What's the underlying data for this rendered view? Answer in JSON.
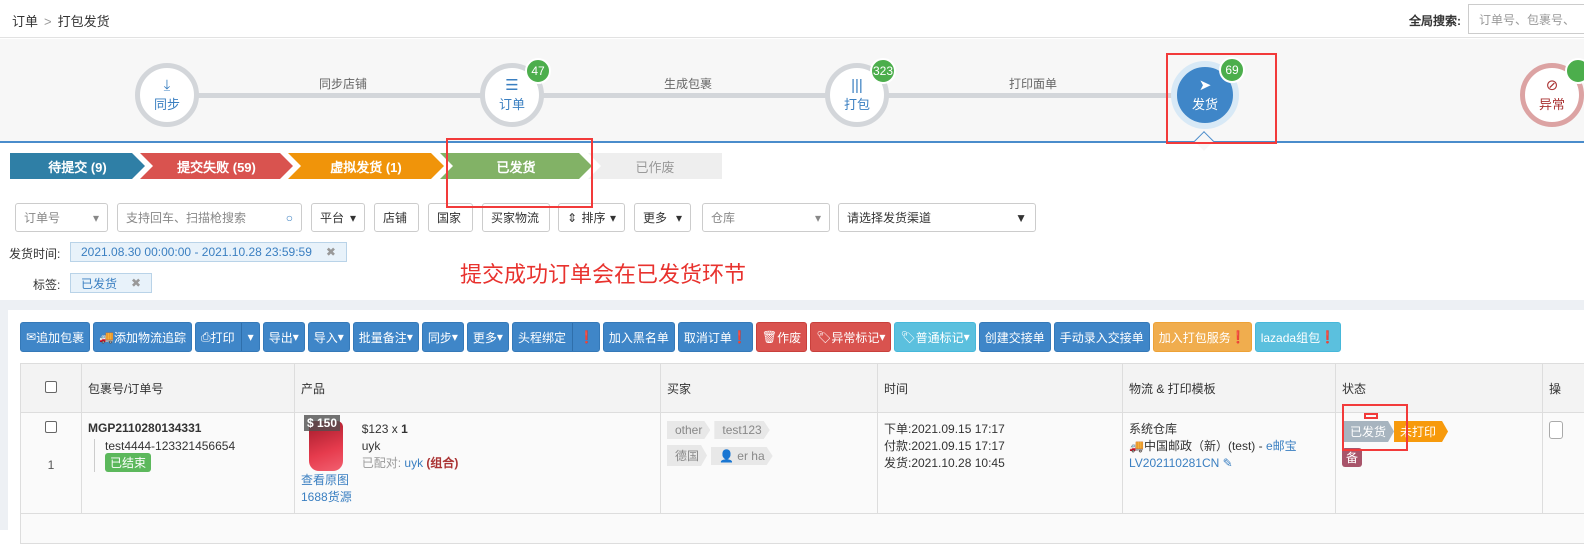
{
  "breadcrumb": {
    "root": "订单",
    "current": "打包发货"
  },
  "global_search": {
    "label": "全局搜索:",
    "placeholder": "订单号、包裹号、"
  },
  "steps": [
    {
      "label": "同步",
      "icon": "download-icon",
      "badge": null
    },
    {
      "label": "订单",
      "icon": "list-icon",
      "badge": "47"
    },
    {
      "label": "打包",
      "icon": "barcode-icon",
      "badge": "323"
    },
    {
      "label": "发货",
      "icon": "paper-plane-icon",
      "badge": "69",
      "active": true
    },
    {
      "label": "异常",
      "icon": "eye-slash-icon",
      "badge": ""
    }
  ],
  "connectors": [
    "同步店铺",
    "生成包裹",
    "打印面单"
  ],
  "status_tabs": [
    {
      "label": "待提交 (9)",
      "color": "#2f7fa6"
    },
    {
      "label": "提交失败 (59)",
      "color": "#d9534f"
    },
    {
      "label": "虚拟发货 (1)",
      "color": "#f0940a"
    },
    {
      "label": "已发货",
      "color": "#82b266",
      "active": true
    },
    {
      "label": "已作废",
      "color": "#eeeeee"
    }
  ],
  "filters": {
    "order_select": "订单号",
    "search_placeholder": "支持回车、扫描枪搜索",
    "platform": "平台",
    "shop": "店铺",
    "country": "国家",
    "buyer_logistics": "买家物流",
    "sort": "排序",
    "more": "更多",
    "warehouse": "仓库",
    "channel": "请选择发货渠道"
  },
  "active_filters": {
    "time_label": "发货时间:",
    "time_value": "2021.08.30 00:00:00 - 2021.10.28 23:59:59",
    "tag_label": "标签:",
    "tag_value": "已发货"
  },
  "annotation": "提交成功订单会在已发货环节",
  "toolbar": [
    "追加包裹",
    "添加物流追踪",
    "打印",
    "导出",
    "导入",
    "批量备注",
    "同步",
    "更多",
    "头程绑定",
    "加入黑名单",
    "取消订单",
    "作废",
    "异常标记",
    "普通标记",
    "创建交接单",
    "手动录入交接单",
    "加入打包服务",
    "lazada组包"
  ],
  "table": {
    "headers": [
      "包裹号/订单号",
      "产品",
      "买家",
      "时间",
      "物流 & 打印模板",
      "状态",
      "操"
    ],
    "rows": [
      {
        "index": "1",
        "package_no": "MGP2110280134331",
        "order_no": "test4444-123321456654",
        "order_status": "已结束",
        "product": {
          "price_badge": "$ 150",
          "price": "$123",
          "qty": "1",
          "name": "uyk",
          "matched_label": "已配对:",
          "matched": "uyk",
          "combo": "(组合)",
          "view_image": "查看原图",
          "source": "1688货源"
        },
        "buyer": {
          "tags": [
            "other",
            "test123"
          ],
          "country": "德国",
          "name": "er ha"
        },
        "times": [
          "下单:2021.09.15 17:17",
          "付款:2021.09.15 17:17",
          "发货:2021.10.28 10:45"
        ],
        "logistics": {
          "warehouse": "系统仓库",
          "carrier": "中国邮政（新）(test) - ",
          "carrier_link": "e邮宝",
          "tracking": "LV202110281CN"
        },
        "status": {
          "shipped": "已发货",
          "print": "未打印",
          "note": "备"
        }
      }
    ]
  }
}
